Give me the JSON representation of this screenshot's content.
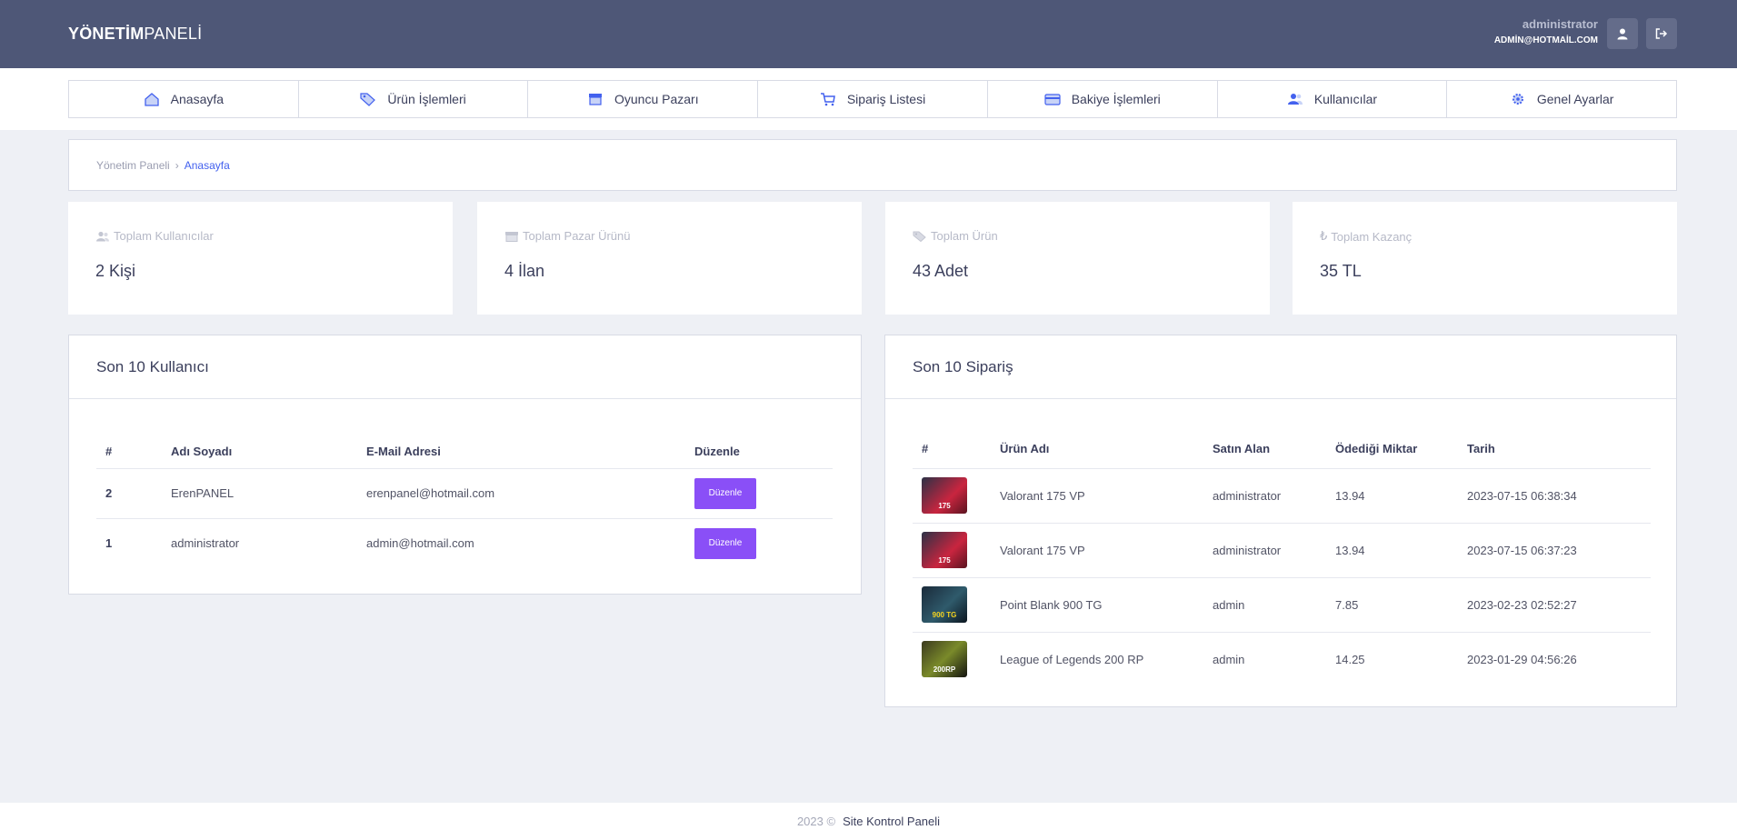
{
  "header": {
    "brand_bold": "YÖNETİM",
    "brand_light": "PANELİ",
    "user_name": "administrator",
    "user_email": "ADMİN@HOTMAİL.COM"
  },
  "nav": [
    {
      "label": "Anasayfa",
      "icon": "home-icon"
    },
    {
      "label": "Ürün İşlemleri",
      "icon": "tag-icon"
    },
    {
      "label": "Oyuncu Pazarı",
      "icon": "store-icon"
    },
    {
      "label": "Sipariş Listesi",
      "icon": "cart-icon"
    },
    {
      "label": "Bakiye İşlemleri",
      "icon": "credit-card-icon"
    },
    {
      "label": "Kullanıcılar",
      "icon": "users-icon"
    },
    {
      "label": "Genel Ayarlar",
      "icon": "gear-icon"
    }
  ],
  "breadcrumb": {
    "root": "Yönetim Paneli",
    "separator": "›",
    "current": "Anasayfa"
  },
  "stats": [
    {
      "label": "Toplam Kullanıcılar",
      "value": "2 Kişi",
      "icon": "users-icon"
    },
    {
      "label": "Toplam Pazar Ürünü",
      "value": "4 İlan",
      "icon": "store-icon"
    },
    {
      "label": "Toplam Ürün",
      "value": "43 Adet",
      "icon": "tag-icon"
    },
    {
      "label": "Toplam Kazanç",
      "value": "35 TL",
      "icon": "lira-icon"
    }
  ],
  "users_panel": {
    "title": "Son 10 Kullanıcı",
    "columns": [
      "#",
      "Adı Soyadı",
      "E-Mail Adresi",
      "Düzenle"
    ],
    "rows": [
      {
        "id": "2",
        "name": "ErenPANEL",
        "email": "erenpanel@hotmail.com",
        "action": "Düzenle"
      },
      {
        "id": "1",
        "name": "administrator",
        "email": "admin@hotmail.com",
        "action": "Düzenle"
      }
    ]
  },
  "orders_panel": {
    "title": "Son 10 Sipariş",
    "columns": [
      "#",
      "Ürün Adı",
      "Satın Alan",
      "Ödediği Miktar",
      "Tarih"
    ],
    "rows": [
      {
        "thumb": "175",
        "product": "Valorant 175 VP",
        "buyer": "administrator",
        "amount": "13.94",
        "date": "2023-07-15 06:38:34"
      },
      {
        "thumb": "175",
        "product": "Valorant 175 VP",
        "buyer": "administrator",
        "amount": "13.94",
        "date": "2023-07-15 06:37:23"
      },
      {
        "thumb": "900 TG",
        "product": "Point Blank 900 TG",
        "buyer": "admin",
        "amount": "7.85",
        "date": "2023-02-23 02:52:27"
      },
      {
        "thumb": "200RP",
        "product": "League of Legends 200 RP",
        "buyer": "admin",
        "amount": "14.25",
        "date": "2023-01-29 04:56:26"
      }
    ]
  },
  "footer": {
    "year": "2023 ©",
    "site": "Site Kontrol Paneli"
  },
  "colors": {
    "header_bg": "#4e5777",
    "accent": "#4361ee",
    "button": "#8a4ff7"
  }
}
